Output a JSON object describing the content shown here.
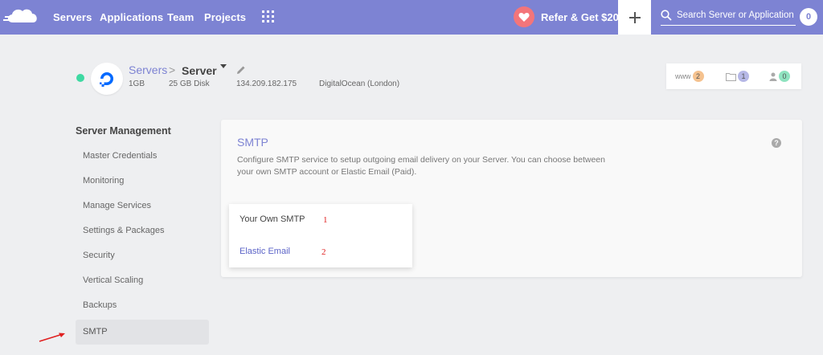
{
  "nav": {
    "links": [
      "Servers",
      "Applications",
      "Team",
      "Projects"
    ],
    "refer_label": "Refer & Get $20",
    "search_placeholder": "Search Server or Application",
    "search_count": "0"
  },
  "server": {
    "breadcrumb_root": "Servers",
    "breadcrumb_sep": ">",
    "name": "Server",
    "ram": "1GB",
    "disk": "25 GB Disk",
    "ip": "134.209.182.175",
    "provider": "DigitalOcean (London)",
    "status_color": "#3ed9a2"
  },
  "stats": {
    "www_label": "www",
    "www_count": "2",
    "folder_count": "1",
    "users_count": "0"
  },
  "sidebar": {
    "title": "Server Management",
    "items": [
      "Master Credentials",
      "Monitoring",
      "Manage Services",
      "Settings & Packages",
      "Security",
      "Vertical Scaling",
      "Backups",
      "SMTP"
    ],
    "active_item": "SMTP"
  },
  "smtp": {
    "title": "SMTP",
    "description": "Configure SMTP service to setup outgoing email delivery on your Server. You can choose between your own SMTP account or Elastic Email (Paid).",
    "options": [
      {
        "label": "Your Own SMTP",
        "annotation": "1"
      },
      {
        "label": "Elastic Email",
        "annotation": "2"
      }
    ]
  },
  "colors": {
    "brand": "#7d83d3",
    "accent_heart": "#f3757a",
    "annotation": "#e02020"
  }
}
